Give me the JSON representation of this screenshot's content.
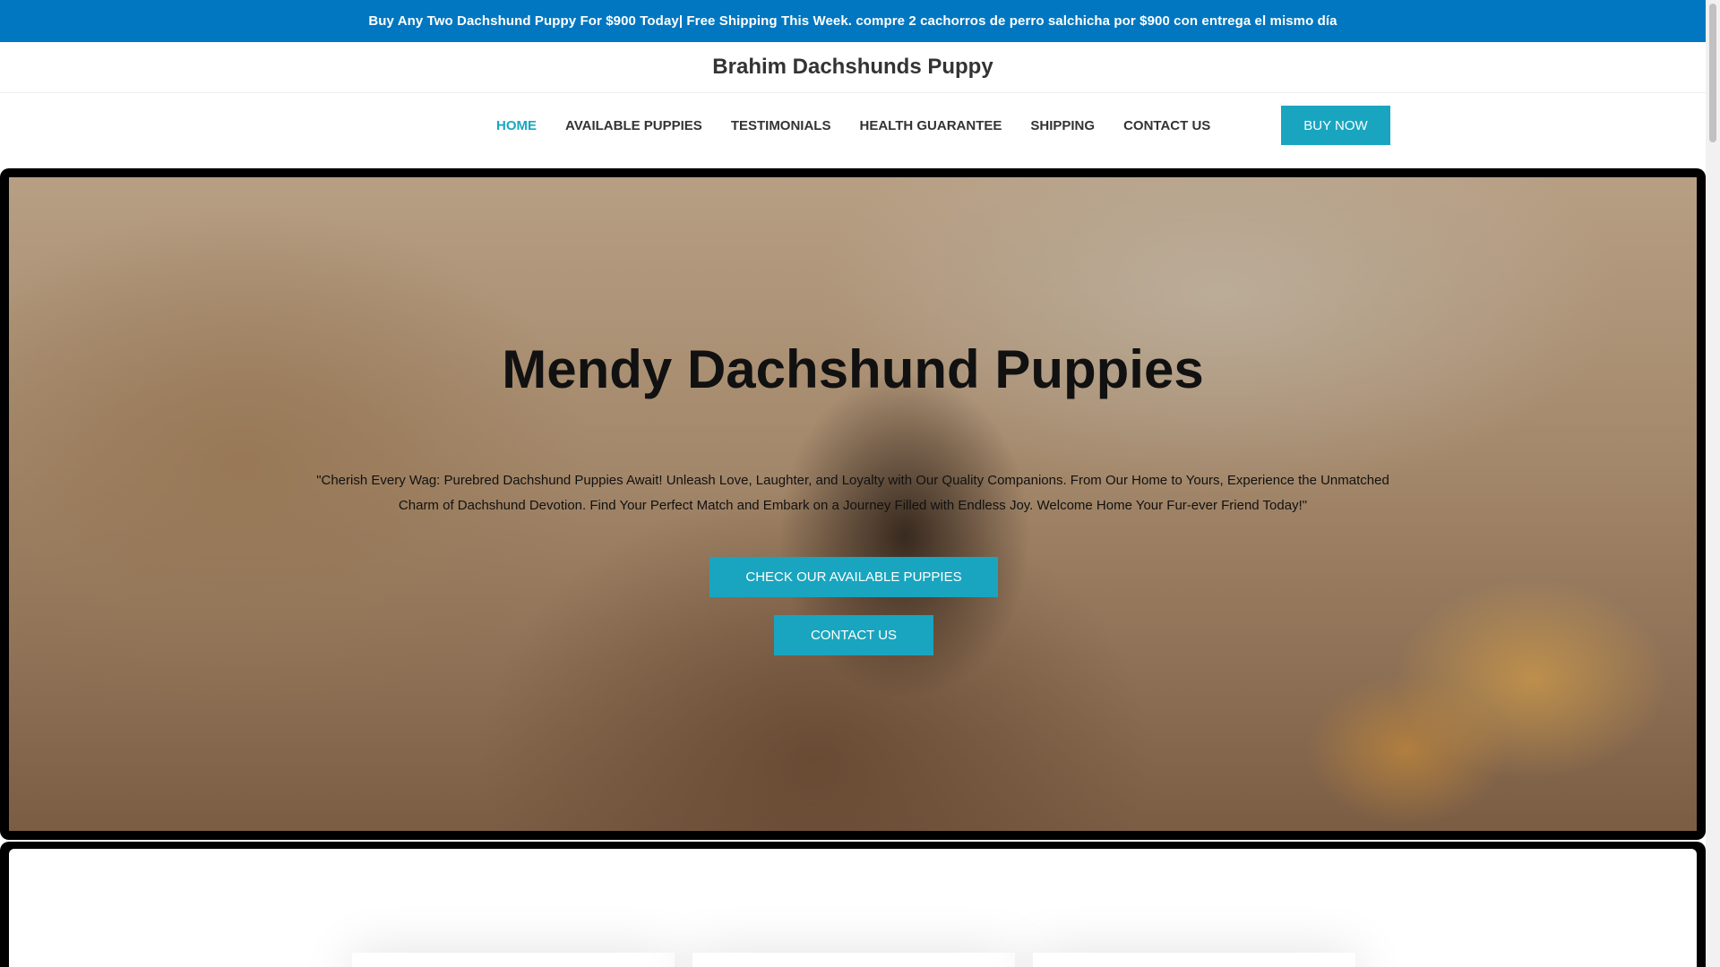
{
  "announcement": {
    "text": "Buy Any Two Dachshund Puppy For $900 Today| Free Shipping This Week. compre 2 cachorros de perro salchicha por $900 con entrega el mismo día"
  },
  "header": {
    "brand": "Brahim Dachshunds Puppy"
  },
  "nav": {
    "items": [
      {
        "label": "HOME",
        "active": true
      },
      {
        "label": "AVAILABLE PUPPIES",
        "active": false
      },
      {
        "label": "TESTIMONIALS",
        "active": false
      },
      {
        "label": "HEALTH GUARANTEE",
        "active": false
      },
      {
        "label": "SHIPPING",
        "active": false
      },
      {
        "label": "CONTACT US",
        "active": false
      }
    ],
    "buy_now": "BUY NOW"
  },
  "hero": {
    "title": "Mendy Dachshund Puppies",
    "text": "\"Cherish Every Wag: Purebred Dachshund Puppies Await! Unleash Love, Laughter, and Loyalty with Our Quality Companions. From Our Home to Yours, Experience the Unmatched Charm of Dachshund Devotion. Find Your Perfect Match and Embark on a Journey Filled with Endless Joy. Welcome Home Your Fur-ever Friend Today!\"",
    "primary_button": "CHECK OUR AVAILABLE PUPPIES",
    "secondary_button": "CONTACT US"
  },
  "colors": {
    "accent": "#19a5bf",
    "announcement_bg": "#0077c0",
    "active_nav": "#19a7c1"
  }
}
